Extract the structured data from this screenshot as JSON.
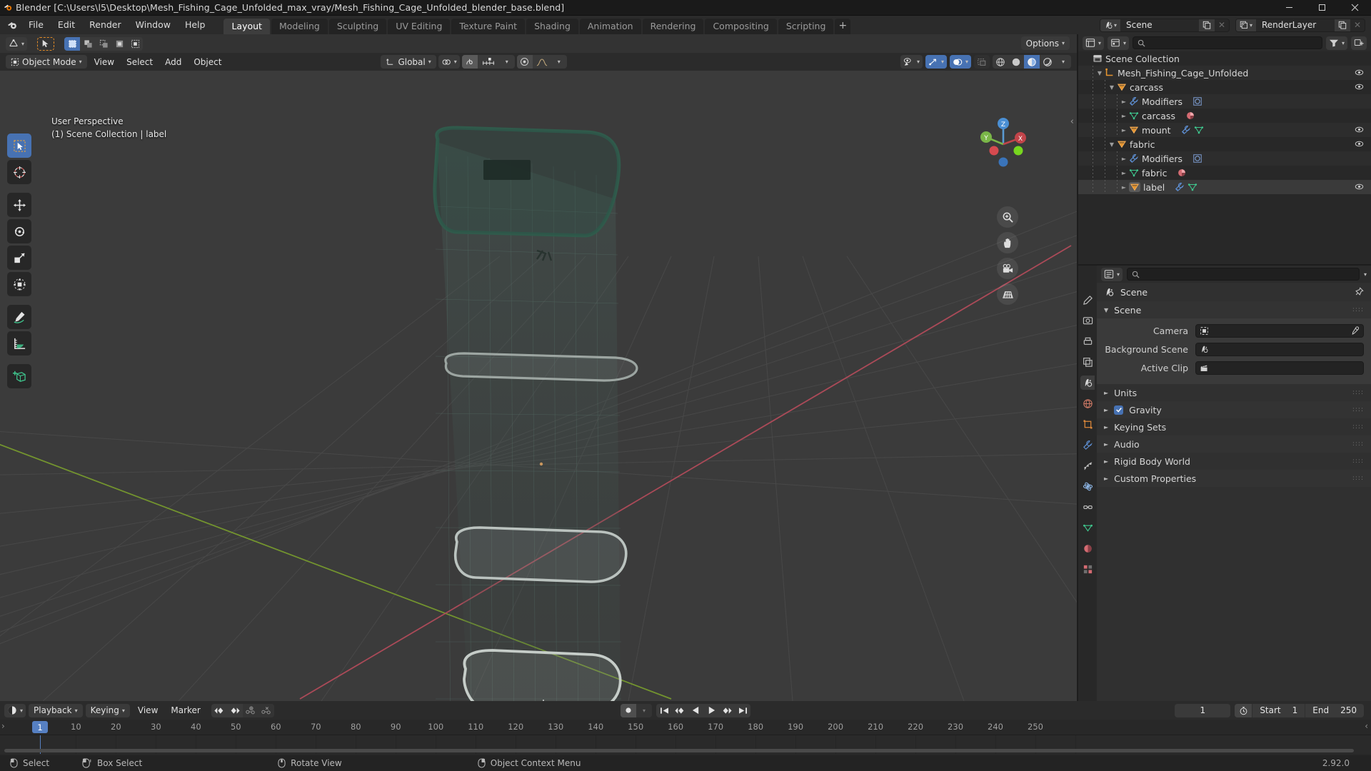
{
  "window": {
    "title": "Blender [C:\\Users\\l5\\Desktop\\Mesh_Fishing_Cage_Unfolded_max_vray/Mesh_Fishing_Cage_Unfolded_blender_base.blend]",
    "minimize": "—",
    "maximize": "☐",
    "close": "✕"
  },
  "topbar": {
    "menus": [
      "File",
      "Edit",
      "Render",
      "Window",
      "Help"
    ],
    "workspaces": [
      {
        "label": "Layout",
        "active": true
      },
      {
        "label": "Modeling",
        "active": false
      },
      {
        "label": "Sculpting",
        "active": false
      },
      {
        "label": "UV Editing",
        "active": false
      },
      {
        "label": "Texture Paint",
        "active": false
      },
      {
        "label": "Shading",
        "active": false
      },
      {
        "label": "Animation",
        "active": false
      },
      {
        "label": "Rendering",
        "active": false
      },
      {
        "label": "Compositing",
        "active": false
      },
      {
        "label": "Scripting",
        "active": false
      }
    ],
    "add_workspace": "+",
    "scene_name": "Scene",
    "viewlayer_name": "RenderLayer"
  },
  "viewport": {
    "editor_type_icon": "editor-type-3d-viewport",
    "mode": "Object Mode",
    "menus": [
      "View",
      "Select",
      "Add",
      "Object"
    ],
    "transform_orientation": "Global",
    "options_label": "Options",
    "overlay_line1": "User Perspective",
    "overlay_line2": "(1) Scene Collection | label",
    "gizmo_axes": {
      "z": "Z",
      "y": "Y",
      "x": "X"
    },
    "tools": [
      {
        "name": "tweak-tool",
        "active": true
      },
      {
        "name": "cursor-tool",
        "active": false
      },
      {
        "name": "move-tool",
        "active": false
      },
      {
        "name": "rotate-tool",
        "active": false
      },
      {
        "name": "scale-tool",
        "active": false
      },
      {
        "name": "transform-tool",
        "active": false
      },
      {
        "name": "annotate-tool",
        "active": false
      },
      {
        "name": "measure-tool",
        "active": false
      },
      {
        "name": "add-cube-tool",
        "active": false
      }
    ]
  },
  "outliner": {
    "display_mode": "view-layer",
    "search_placeholder": "",
    "rows": [
      {
        "indent": 0,
        "label": "Scene Collection",
        "icon": "collection-icon",
        "disclosure": "",
        "eye": false,
        "selected": false
      },
      {
        "indent": 1,
        "label": "Mesh_Fishing_Cage_Unfolded",
        "icon": "armature-icon",
        "disclosure": "down",
        "eye": true,
        "selected": false
      },
      {
        "indent": 2,
        "label": "carcass",
        "icon": "mesh-object-icon",
        "disclosure": "down",
        "eye": true,
        "selected": false
      },
      {
        "indent": 3,
        "label": "Modifiers",
        "icon": "wrench-icon",
        "disclosure": "right",
        "eye": false,
        "selected": false,
        "extra": [
          "modifier-solidify-icon"
        ]
      },
      {
        "indent": 3,
        "label": "carcass",
        "icon": "mesh-data-icon",
        "disclosure": "right",
        "eye": false,
        "selected": false,
        "extra": [
          "material-icon"
        ]
      },
      {
        "indent": 3,
        "label": "mount",
        "icon": "mesh-object-icon",
        "disclosure": "right",
        "eye": true,
        "selected": false,
        "extra": [
          "wrench-icon",
          "mesh-data-icon"
        ]
      },
      {
        "indent": 2,
        "label": "fabric",
        "icon": "mesh-object-icon",
        "disclosure": "down",
        "eye": true,
        "selected": false
      },
      {
        "indent": 3,
        "label": "Modifiers",
        "icon": "wrench-icon",
        "disclosure": "right",
        "eye": false,
        "selected": false,
        "extra": [
          "modifier-solidify-icon"
        ]
      },
      {
        "indent": 3,
        "label": "fabric",
        "icon": "mesh-data-icon",
        "disclosure": "right",
        "eye": false,
        "selected": false,
        "extra": [
          "material-icon"
        ]
      },
      {
        "indent": 3,
        "label": "label",
        "icon": "mesh-object-icon",
        "disclosure": "right",
        "eye": true,
        "selected": true,
        "extra": [
          "wrench-icon",
          "mesh-data-icon"
        ]
      }
    ]
  },
  "properties": {
    "search_placeholder": "",
    "breadcrumb": "Scene",
    "tabs": [
      {
        "name": "tool-tab",
        "selected": false
      },
      {
        "name": "render-tab",
        "selected": false
      },
      {
        "name": "output-tab",
        "selected": false
      },
      {
        "name": "view-layer-tab",
        "selected": false
      },
      {
        "name": "scene-tab",
        "selected": true
      },
      {
        "name": "world-tab",
        "selected": false
      },
      {
        "name": "object-tab",
        "selected": false
      },
      {
        "name": "modifier-tab",
        "selected": false
      },
      {
        "name": "particles-tab",
        "selected": false
      },
      {
        "name": "physics-tab",
        "selected": false
      },
      {
        "name": "constraints-tab",
        "selected": false
      },
      {
        "name": "data-tab",
        "selected": false
      },
      {
        "name": "material-tab",
        "selected": false
      },
      {
        "name": "texture-tab",
        "selected": false
      }
    ],
    "scene_panel": {
      "title": "Scene",
      "fields": [
        {
          "label": "Camera",
          "value": "",
          "icon": "camera-icon",
          "eyedropper": true
        },
        {
          "label": "Background Scene",
          "value": "",
          "icon": "scene-icon",
          "eyedropper": false
        },
        {
          "label": "Active Clip",
          "value": "",
          "icon": "clip-icon",
          "eyedropper": false
        }
      ]
    },
    "collapsed_panels": [
      {
        "label": "Units",
        "checkbox": null
      },
      {
        "label": "Gravity",
        "checkbox": true
      },
      {
        "label": "Keying Sets",
        "checkbox": null
      },
      {
        "label": "Audio",
        "checkbox": null
      },
      {
        "label": "Rigid Body World",
        "checkbox": null
      },
      {
        "label": "Custom Properties",
        "checkbox": null
      }
    ]
  },
  "timeline": {
    "editor_icon": "timeline-icon",
    "menus": [
      "Playback",
      "Keying",
      "View",
      "Marker"
    ],
    "current_frame": "1",
    "start_label": "Start",
    "start_value": "1",
    "end_label": "End",
    "end_value": "250",
    "ruler_ticks": [
      "1",
      "10",
      "20",
      "30",
      "40",
      "50",
      "60",
      "70",
      "80",
      "90",
      "100",
      "110",
      "120",
      "130",
      "140",
      "150",
      "160",
      "170",
      "180",
      "190",
      "200",
      "210",
      "220",
      "230",
      "240",
      "250"
    ],
    "playhead_frame": "1"
  },
  "statusbar": {
    "items": [
      {
        "label": "Select",
        "icon": "mouse-left-icon"
      },
      {
        "label": "Box Select",
        "icon": "mouse-left-drag-icon"
      },
      {
        "label": "Rotate View",
        "icon": "mouse-middle-icon"
      },
      {
        "label": "Object Context Menu",
        "icon": "mouse-right-icon"
      }
    ],
    "version": "2.92.0"
  },
  "colors": {
    "accent_blue": "#4772b3",
    "header_bg": "#2b2b2b",
    "panel_bg": "#303030",
    "viewport_bg": "#303030",
    "axis_x_red": "#b14b5a",
    "axis_y_green": "#7a9e2e",
    "object_orange": "#e5942e",
    "mesh_green": "#3fc78e"
  }
}
